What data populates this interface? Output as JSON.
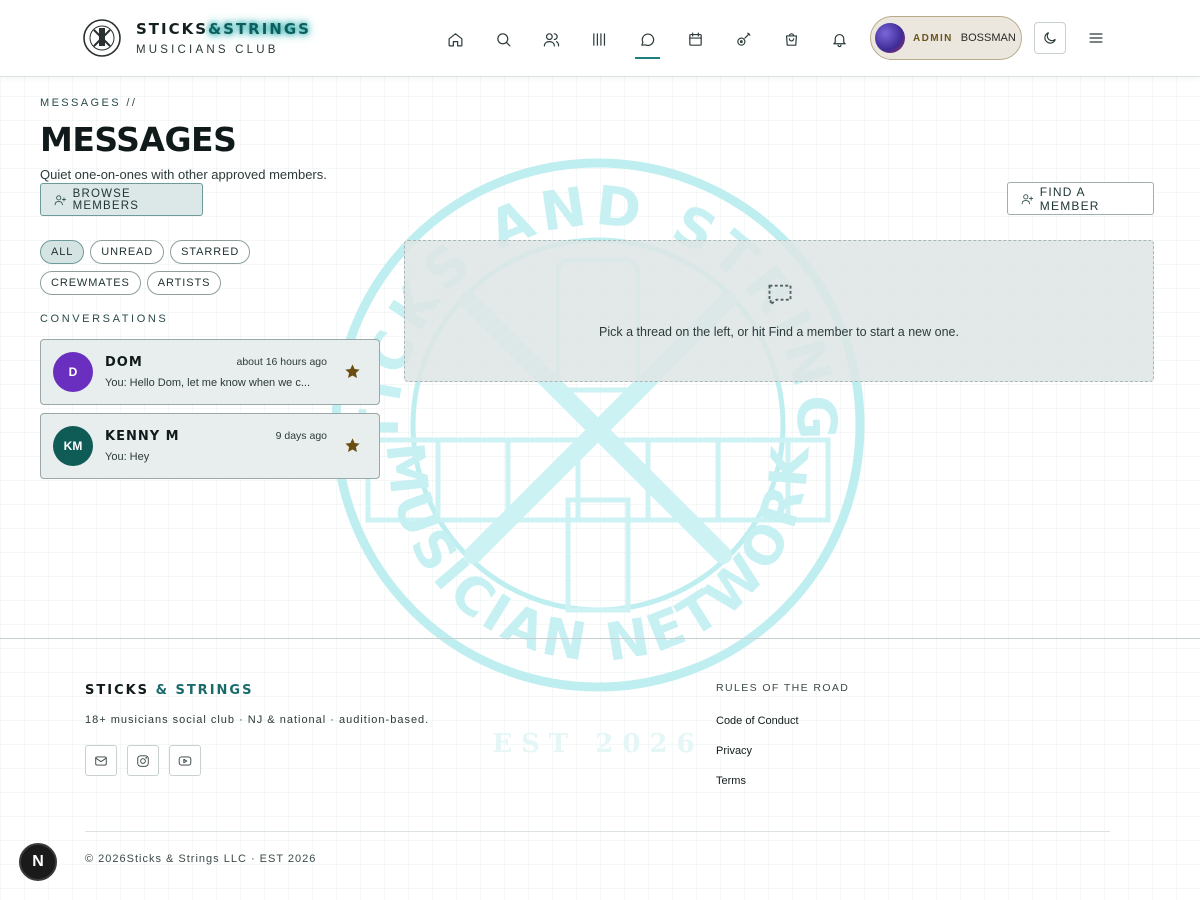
{
  "header": {
    "brand_main": "STICKS",
    "brand_accent": "&STRINGS",
    "brand_sub": "MUSICIANS CLUB",
    "nav_icons": [
      "home-icon",
      "search-icon",
      "members-icon",
      "library-icon",
      "messages-icon",
      "calendar-icon",
      "guitar-icon",
      "shop-icon",
      "bell-icon"
    ],
    "active_nav": "messages-icon",
    "user": {
      "role": "ADMIN",
      "name": "BOSSMAN"
    }
  },
  "page": {
    "breadcrumb": "MESSAGES //",
    "title": "MESSAGES",
    "subtitle": "Quiet one-on-ones with other approved members.",
    "browse_button": "BROWSE MEMBERS",
    "find_button": "FIND A MEMBER"
  },
  "filters": [
    {
      "label": "ALL",
      "active": true
    },
    {
      "label": "UNREAD",
      "active": false
    },
    {
      "label": "STARRED",
      "active": false
    },
    {
      "label": "CREWMATES",
      "active": false
    },
    {
      "label": "ARTISTS",
      "active": false
    }
  ],
  "conversations_label": "CONVERSATIONS",
  "conversations": [
    {
      "initials": "D",
      "name": "DOM",
      "time": "about 16 hours ago",
      "preview": "You: Hello Dom, let me know when we c...",
      "color": "#6a2fbf",
      "starred": true
    },
    {
      "initials": "KM",
      "name": "KENNY M",
      "time": "9 days ago",
      "preview": "You: Hey",
      "color": "#0f5b55",
      "starred": true
    }
  ],
  "empty_state": "Pick a thread on the left, or hit Find a member to start a new one.",
  "watermark": {
    "top": "STICKS AND STRINGS",
    "bottom": "MUSICIAN NETWORK",
    "est": "EST 2026",
    "color": "#bfeef0"
  },
  "footer": {
    "brand_a": "STICKS",
    "brand_amp": "&",
    "brand_b": "STRINGS",
    "tagline": "18+ musicians social club · NJ & national · audition-based.",
    "socials": [
      "mail-icon",
      "instagram-icon",
      "youtube-icon"
    ],
    "links_heading": "RULES OF THE ROAD",
    "links": [
      "Code of Conduct",
      "Privacy",
      "Terms"
    ],
    "copyright": "© 2026Sticks & Strings LLC · EST 2026"
  },
  "dev_badge": "N",
  "colors": {
    "accent": "#1a6a6a",
    "star": "#6b4d12",
    "panel": "#e8eded"
  }
}
